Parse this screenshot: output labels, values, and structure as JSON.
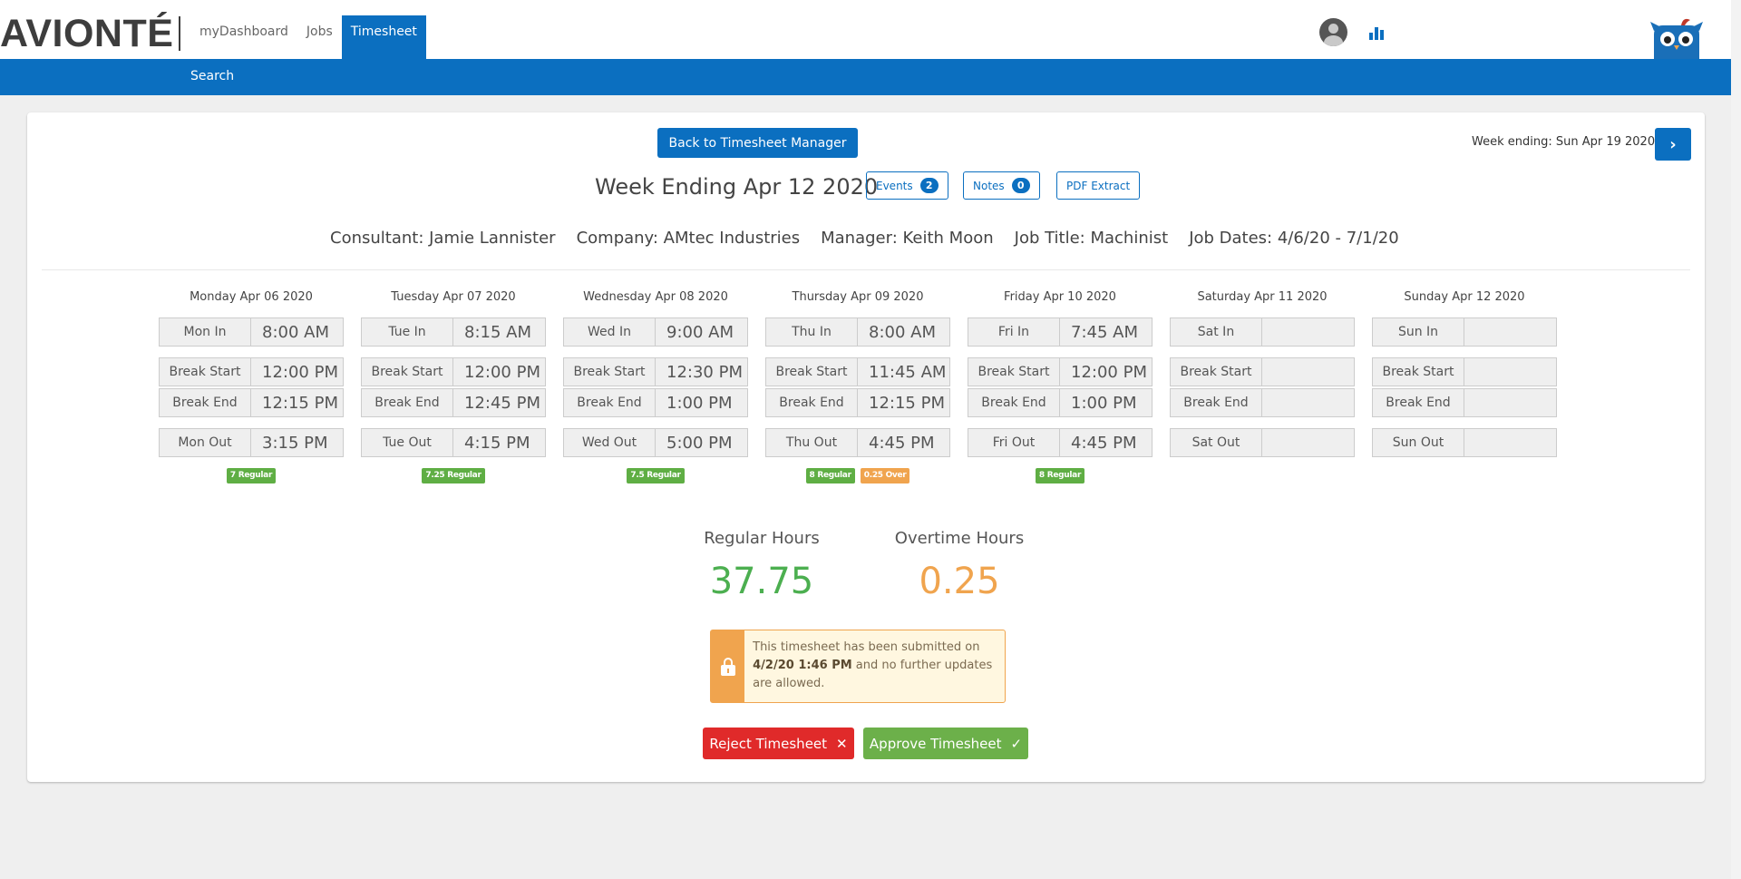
{
  "app": {
    "logo": "AVIONTÉ",
    "nav": [
      "myDashboard",
      "Jobs",
      "Timesheet"
    ],
    "active_nav": "Timesheet",
    "subnav": "Search",
    "icons": [
      "user-avatar-icon",
      "bar-chart-icon",
      "owl-mascot-icon"
    ],
    "colors": {
      "primary": "#0b6fc0",
      "green": "#5fae44",
      "orange": "#f0a44e",
      "red": "#e02a2a"
    }
  },
  "header": {
    "back_button": "Back to Timesheet Manager",
    "week_ending_next": "Week ending: Sun Apr 19 2020",
    "title": "Week Ending Apr 12 2020",
    "events_label": "Events",
    "events_count": "2",
    "notes_label": "Notes",
    "notes_count": "0",
    "pdf_label": "PDF Extract"
  },
  "info": {
    "consultant": "Consultant: Jamie Lannister",
    "company": "Company: AMtec Industries",
    "manager": "Manager: Keith Moon",
    "job_title": "Job Title: Machinist",
    "job_dates": "Job Dates: 4/6/20 - 7/1/20"
  },
  "days": [
    {
      "title": "Monday Apr 06 2020",
      "in_label": "Mon In",
      "in": "8:00 AM",
      "bs_label": "Break Start",
      "bs": "12:00 PM",
      "be_label": "Break End",
      "be": "12:15 PM",
      "out_label": "Mon Out",
      "out": "3:15 PM",
      "tags": [
        {
          "text": "7 Regular",
          "type": "green"
        }
      ]
    },
    {
      "title": "Tuesday Apr 07 2020",
      "in_label": "Tue In",
      "in": "8:15 AM",
      "bs_label": "Break Start",
      "bs": "12:00 PM",
      "be_label": "Break End",
      "be": "12:45 PM",
      "out_label": "Tue Out",
      "out": "4:15 PM",
      "tags": [
        {
          "text": "7.25 Regular",
          "type": "green"
        }
      ]
    },
    {
      "title": "Wednesday Apr 08 2020",
      "in_label": "Wed In",
      "in": "9:00 AM",
      "bs_label": "Break Start",
      "bs": "12:30 PM",
      "be_label": "Break End",
      "be": "1:00 PM",
      "out_label": "Wed Out",
      "out": "5:00 PM",
      "tags": [
        {
          "text": "7.5 Regular",
          "type": "green"
        }
      ]
    },
    {
      "title": "Thursday Apr 09 2020",
      "in_label": "Thu In",
      "in": "8:00 AM",
      "bs_label": "Break Start",
      "bs": "11:45 AM",
      "be_label": "Break End",
      "be": "12:15 PM",
      "out_label": "Thu Out",
      "out": "4:45 PM",
      "tags": [
        {
          "text": "8 Regular",
          "type": "green"
        },
        {
          "text": "0.25 Over",
          "type": "orange"
        }
      ]
    },
    {
      "title": "Friday Apr 10 2020",
      "in_label": "Fri In",
      "in": "7:45 AM",
      "bs_label": "Break Start",
      "bs": "12:00 PM",
      "be_label": "Break End",
      "be": "1:00 PM",
      "out_label": "Fri Out",
      "out": "4:45 PM",
      "tags": [
        {
          "text": "8 Regular",
          "type": "green"
        }
      ]
    },
    {
      "title": "Saturday Apr 11 2020",
      "in_label": "Sat In",
      "in": "",
      "bs_label": "Break Start",
      "bs": "",
      "be_label": "Break End",
      "be": "",
      "out_label": "Sat Out",
      "out": "",
      "tags": []
    },
    {
      "title": "Sunday Apr 12 2020",
      "in_label": "Sun In",
      "in": "",
      "bs_label": "Break Start",
      "bs": "",
      "be_label": "Break End",
      "be": "",
      "out_label": "Sun Out",
      "out": "",
      "tags": []
    }
  ],
  "totals": {
    "regular_label": "Regular Hours",
    "regular_value": "37.75",
    "overtime_label": "Overtime Hours",
    "overtime_value": "0.25"
  },
  "notice": {
    "line1": "This timesheet has been submitted on",
    "date": "4/2/20 1:46 PM",
    "line2": " and no further updates are allowed."
  },
  "actions": {
    "reject": "Reject Timesheet",
    "reject_icon": "✕",
    "approve": "Approve Timesheet",
    "approve_icon": "✓"
  }
}
